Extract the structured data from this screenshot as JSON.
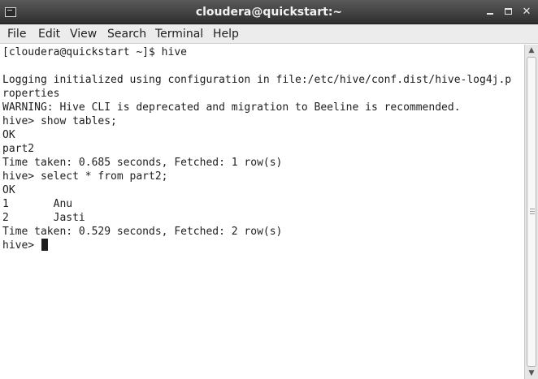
{
  "window": {
    "title": "cloudera@quickstart:~",
    "controls": {
      "minimize_icon": "minimize-icon",
      "maximize_icon": "maximize-icon",
      "close_icon": "close-icon"
    }
  },
  "menu": {
    "items": [
      {
        "label": "File"
      },
      {
        "label": "Edit"
      },
      {
        "label": "View"
      },
      {
        "label": "Search"
      },
      {
        "label": "Terminal"
      },
      {
        "label": "Help"
      }
    ]
  },
  "terminal": {
    "lines": [
      "[cloudera@quickstart ~]$ hive",
      "",
      "Logging initialized using configuration in file:/etc/hive/conf.dist/hive-log4j.p",
      "roperties",
      "WARNING: Hive CLI is deprecated and migration to Beeline is recommended.",
      "hive> show tables;",
      "OK",
      "part2",
      "Time taken: 0.685 seconds, Fetched: 1 row(s)",
      "hive> select * from part2;",
      "OK",
      "1       Anu",
      "2       Jasti",
      "Time taken: 0.529 seconds, Fetched: 2 row(s)"
    ],
    "prompt": "hive> "
  }
}
